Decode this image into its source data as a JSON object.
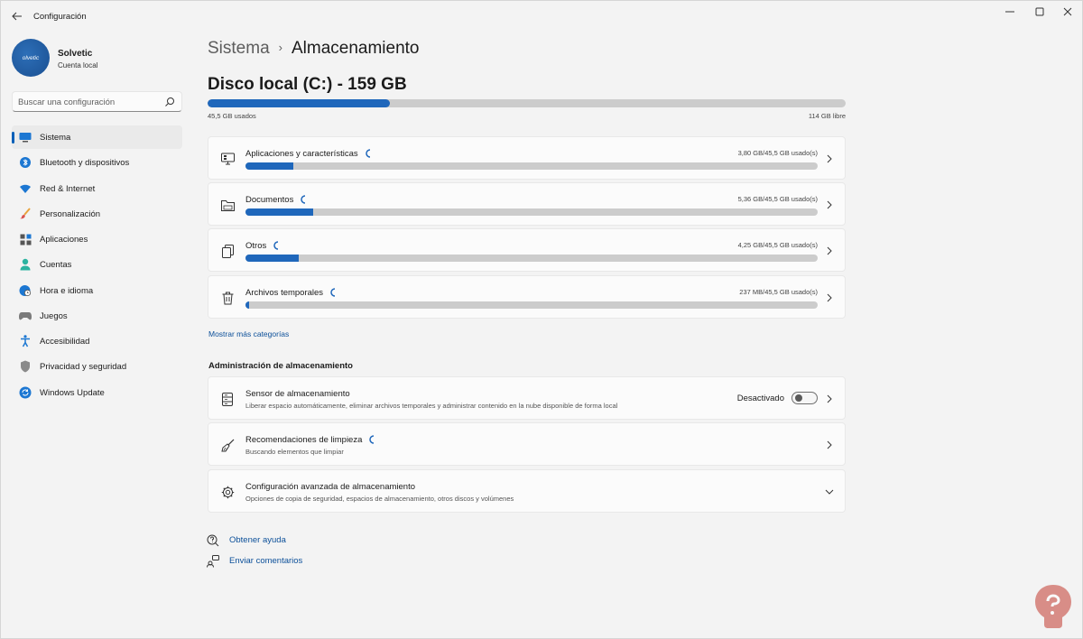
{
  "window": {
    "title": "Configuración",
    "back_icon": "back-arrow-icon",
    "controls": [
      "minimize-icon",
      "maximize-icon",
      "close-icon"
    ]
  },
  "profile": {
    "avatar_text": "olvetic",
    "name": "Solvetic",
    "account_type": "Cuenta local"
  },
  "search": {
    "placeholder": "Buscar una configuración",
    "icon": "search-icon"
  },
  "sidebar": {
    "items": [
      {
        "label": "Sistema",
        "icon": "monitor-icon",
        "active": true
      },
      {
        "label": "Bluetooth y dispositivos",
        "icon": "bluetooth-icon"
      },
      {
        "label": "Red & Internet",
        "icon": "wifi-icon"
      },
      {
        "label": "Personalización",
        "icon": "brush-icon"
      },
      {
        "label": "Aplicaciones",
        "icon": "apps-icon"
      },
      {
        "label": "Cuentas",
        "icon": "person-icon"
      },
      {
        "label": "Hora e idioma",
        "icon": "globe-clock-icon"
      },
      {
        "label": "Juegos",
        "icon": "gamepad-icon"
      },
      {
        "label": "Accesibilidad",
        "icon": "accessibility-icon"
      },
      {
        "label": "Privacidad y seguridad",
        "icon": "shield-icon"
      },
      {
        "label": "Windows Update",
        "icon": "update-icon"
      }
    ]
  },
  "breadcrumb": {
    "parent": "Sistema",
    "separator": "›",
    "current": "Almacenamiento"
  },
  "disk": {
    "title": "Disco local (C:) - 159 GB",
    "used_label": "45,5 GB usados",
    "free_label": "114 GB libre",
    "used_fraction": 0.286
  },
  "categories": [
    {
      "label": "Aplicaciones y características",
      "icon": "apps-monitor-icon",
      "size": "3,80 GB/45,5 GB usado(s)",
      "fraction": 0.083
    },
    {
      "label": "Documentos",
      "icon": "folder-icon",
      "size": "5,36 GB/45,5 GB usado(s)",
      "fraction": 0.118
    },
    {
      "label": "Otros",
      "icon": "pages-icon",
      "size": "4,25 GB/45,5 GB usado(s)",
      "fraction": 0.093
    },
    {
      "label": "Archivos temporales",
      "icon": "trash-icon",
      "size": "237 MB/45,5 GB usado(s)",
      "fraction": 0.005
    }
  ],
  "more_categories_link": "Mostrar más categorías",
  "management": {
    "section_title": "Administración de almacenamiento",
    "items": [
      {
        "title": "Sensor de almacenamiento",
        "subtitle": "Liberar espacio automáticamente, eliminar archivos temporales y administrar contenido en la nube disponible de forma local",
        "icon": "storage-drive-icon",
        "toggle_label": "Desactivado",
        "toggle_on": false
      },
      {
        "title": "Recomendaciones de limpieza",
        "subtitle": "Buscando elementos que limpiar",
        "icon": "broom-icon"
      },
      {
        "title": "Configuración avanzada de almacenamiento",
        "subtitle": "Opciones de copia de seguridad, espacios de almacenamiento, otros discos y volúmenes",
        "icon": "gear-icon"
      }
    ]
  },
  "help": {
    "get_help": "Obtener ayuda",
    "feedback": "Enviar comentarios"
  },
  "colors": {
    "accent": "#1f67bb",
    "link": "#0b4f99",
    "background": "#f3f3f3",
    "card": "#fbfbfb"
  }
}
